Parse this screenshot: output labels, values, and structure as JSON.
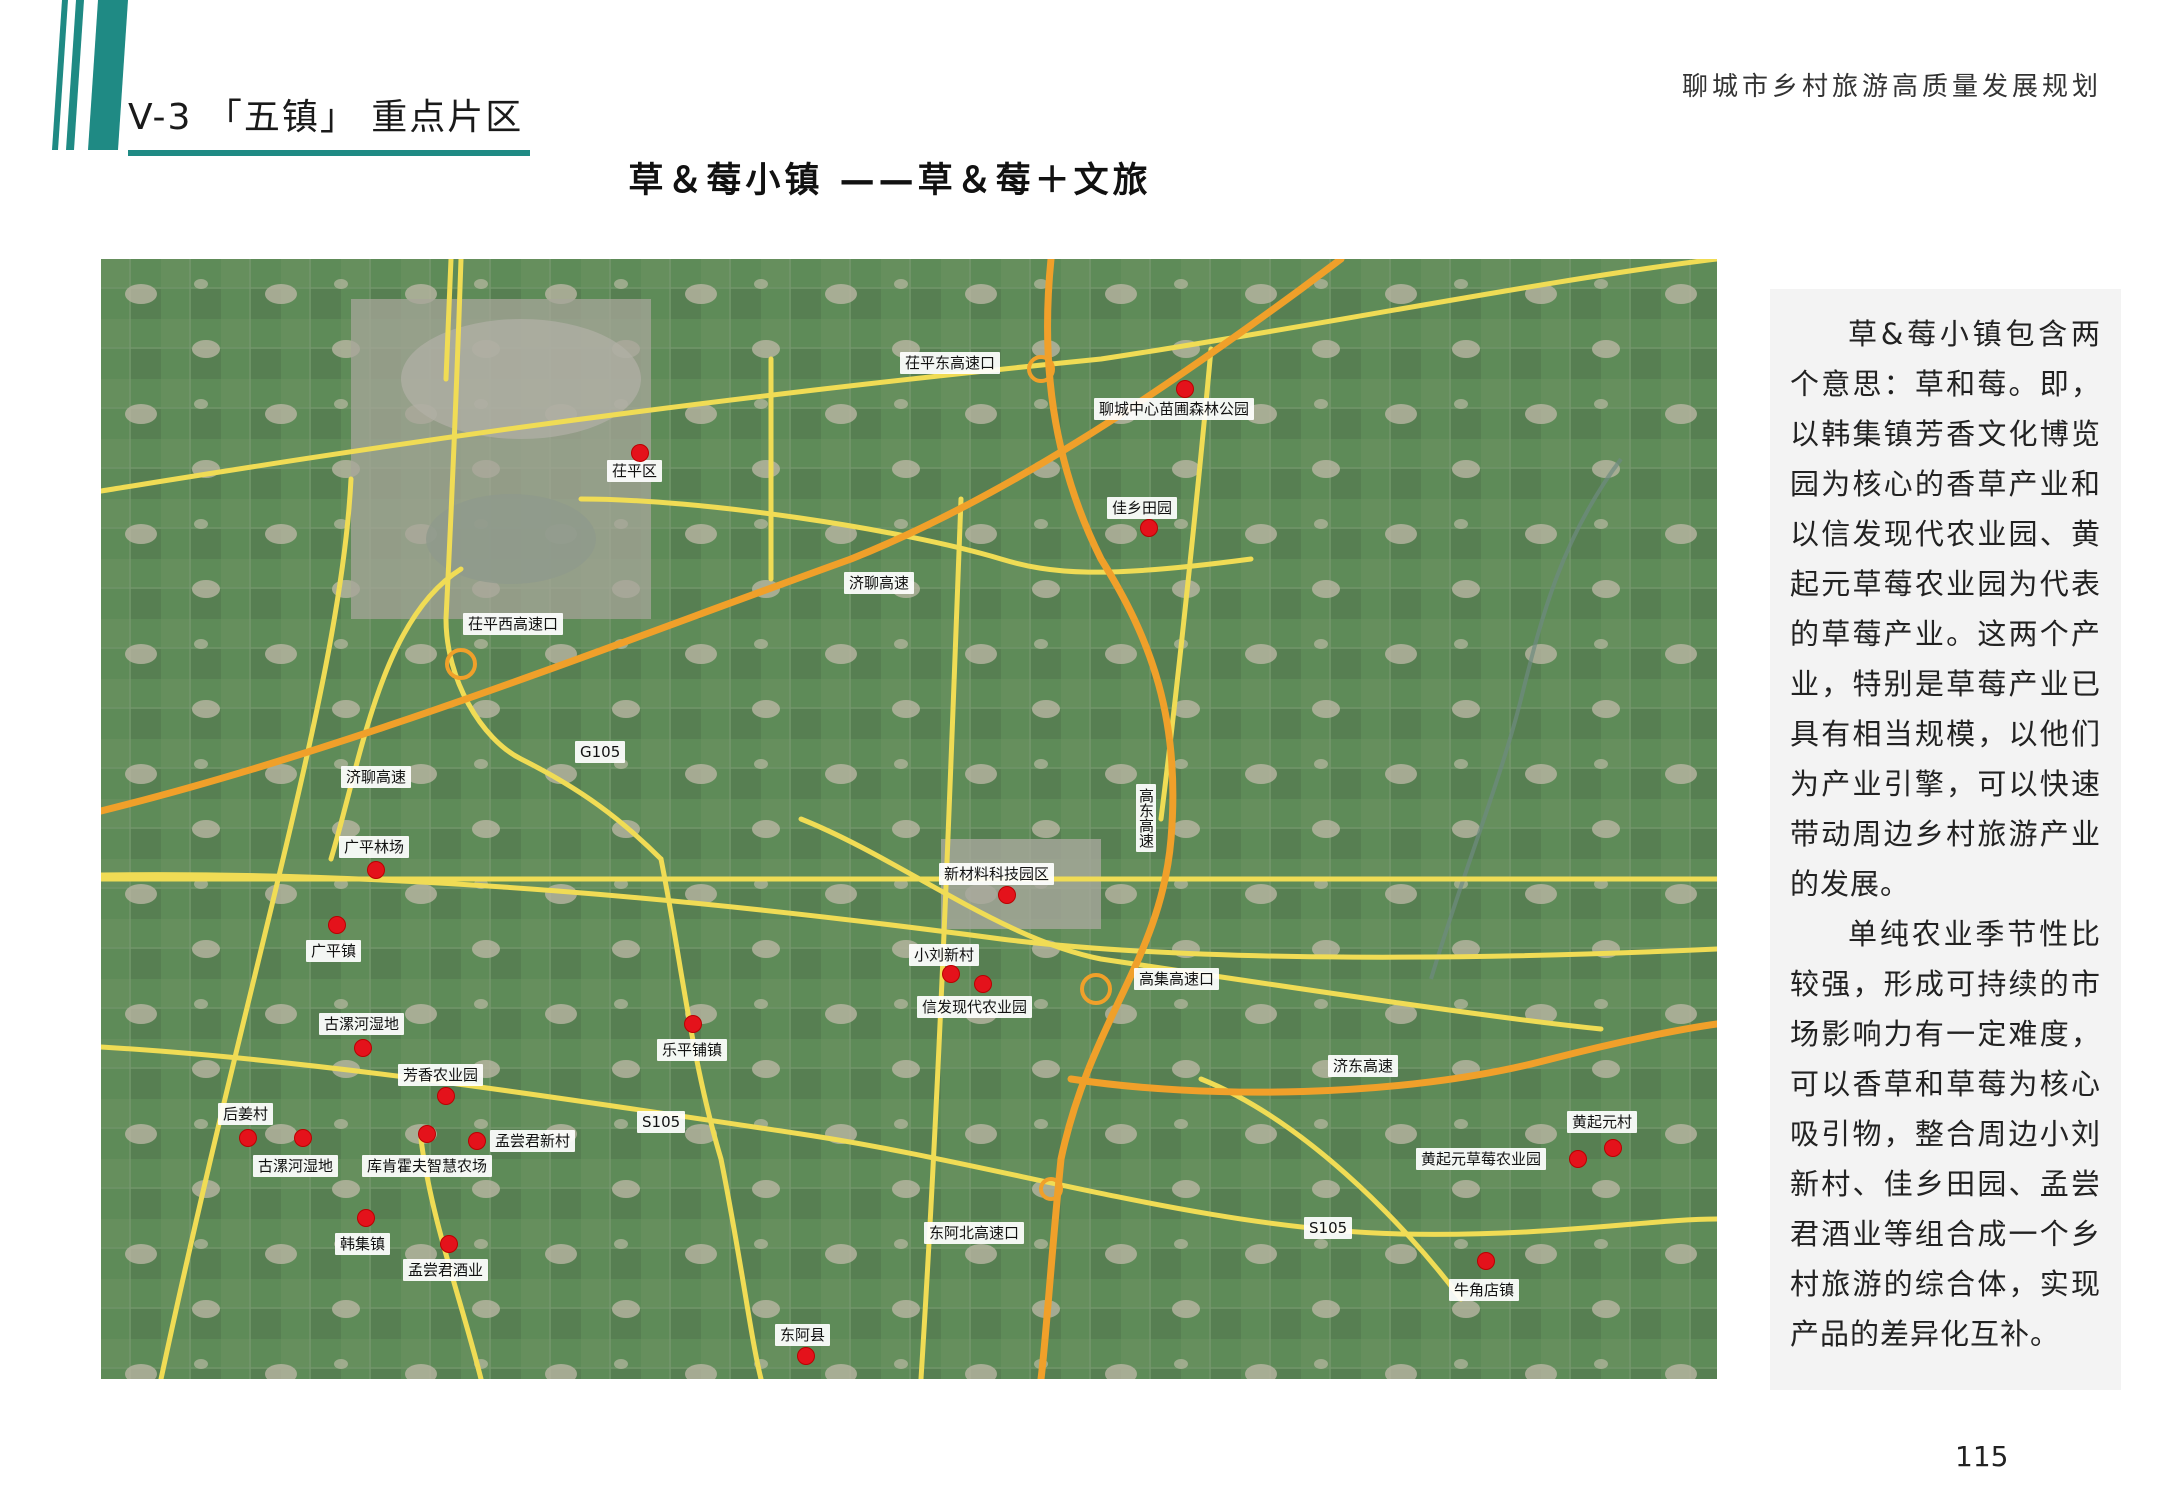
{
  "header": {
    "section_title": "V-3 「五镇」 重点片区",
    "doc_title": "聊城市乡村旅游高质量发展规划",
    "map_title": "草＆莓小镇 ——草＆莓＋文旅"
  },
  "colors": {
    "accent": "#1f8a84",
    "marker": "#e4121b",
    "expressway": "#f0a02a",
    "road": "#f0dc55"
  },
  "map": {
    "places": [
      {
        "name": "茌平东高速口",
        "kind": "road-label"
      },
      {
        "name": "聊城中心苗圃森林公园",
        "kind": "poi"
      },
      {
        "name": "茌平区",
        "kind": "poi"
      },
      {
        "name": "佳乡田园",
        "kind": "poi"
      },
      {
        "name": "济聊高速",
        "kind": "road-label"
      },
      {
        "name": "茌平西高速口",
        "kind": "road-label"
      },
      {
        "name": "G105",
        "kind": "road-label"
      },
      {
        "name": "济聊高速",
        "kind": "road-label"
      },
      {
        "name": "高东高速",
        "kind": "road-label"
      },
      {
        "name": "广平林场",
        "kind": "poi"
      },
      {
        "name": "新材料科技园区",
        "kind": "poi"
      },
      {
        "name": "广平镇",
        "kind": "poi"
      },
      {
        "name": "小刘新村",
        "kind": "poi"
      },
      {
        "name": "高集高速口",
        "kind": "road-label"
      },
      {
        "name": "信发现代农业园",
        "kind": "poi"
      },
      {
        "name": "古漯河湿地",
        "kind": "poi"
      },
      {
        "name": "乐平铺镇",
        "kind": "poi"
      },
      {
        "name": "芳香农业园",
        "kind": "poi"
      },
      {
        "name": "济东高速",
        "kind": "road-label"
      },
      {
        "name": "后姜村",
        "kind": "poi"
      },
      {
        "name": "S105",
        "kind": "road-label"
      },
      {
        "name": "孟尝君新村",
        "kind": "poi"
      },
      {
        "name": "黄起元村",
        "kind": "poi"
      },
      {
        "name": "古漯河湿地",
        "kind": "poi"
      },
      {
        "name": "库肯霍夫智慧农场",
        "kind": "poi"
      },
      {
        "name": "黄起元草莓农业园",
        "kind": "poi"
      },
      {
        "name": "东阿北高速口",
        "kind": "road-label"
      },
      {
        "name": "S105",
        "kind": "road-label"
      },
      {
        "name": "韩集镇",
        "kind": "poi"
      },
      {
        "name": "孟尝君酒业",
        "kind": "poi"
      },
      {
        "name": "牛角店镇",
        "kind": "poi"
      },
      {
        "name": "东阿县",
        "kind": "poi"
      }
    ]
  },
  "panel": {
    "paragraphs": [
      "草&莓小镇包含两个意思：草和莓。即，以韩集镇芳香文化博览园为核心的香草产业和以信发现代农业园、黄起元草莓农业园为代表的草莓产业。这两个产业，特别是草莓产业已具有相当规模，以他们为产业引擎，可以快速带动周边乡村旅游产业的发展。",
      "单纯农业季节性比较强，形成可持续的市场影响力有一定难度，可以香草和草莓为核心吸引物，整合周边小刘新村、佳乡田园、孟尝君酒业等组合成一个乡村旅游的综合体，实现产品的差异化互补。"
    ]
  },
  "page_number": "115"
}
